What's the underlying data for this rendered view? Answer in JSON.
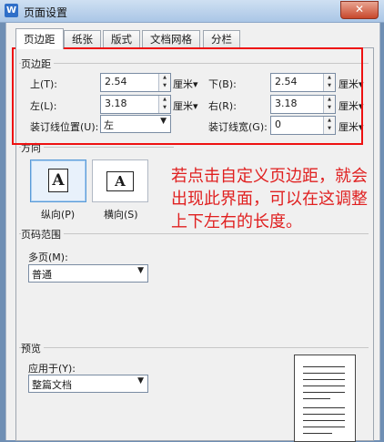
{
  "window": {
    "title": "页面设置",
    "app_icon": "W",
    "close_glyph": "✕"
  },
  "tabs": [
    "页边距",
    "纸张",
    "版式",
    "文档网格",
    "分栏"
  ],
  "margins": {
    "group_label": "页边距",
    "top": {
      "label": "上(T):",
      "value": "2.54",
      "unit": "厘米"
    },
    "bottom": {
      "label": "下(B):",
      "value": "2.54",
      "unit": "厘米"
    },
    "left": {
      "label": "左(L):",
      "value": "3.18",
      "unit": "厘米"
    },
    "right": {
      "label": "右(R):",
      "value": "3.18",
      "unit": "厘米"
    },
    "gutter_position": {
      "label": "装订线位置(U):",
      "value": "左"
    },
    "gutter_width": {
      "label": "装订线宽(G):",
      "value": "0",
      "unit": "厘米"
    }
  },
  "orientation": {
    "group_label": "方向",
    "portrait": {
      "label": "纵向(P)",
      "glyph": "A"
    },
    "landscape": {
      "label": "横向(S)",
      "glyph": "A"
    }
  },
  "page_range": {
    "group_label": "页码范围",
    "multiple_pages_label": "多页(M):",
    "multiple_pages_value": "普通"
  },
  "preview": {
    "group_label": "预览",
    "apply_to_label": "应用于(Y):",
    "apply_to_value": "整篇文档"
  },
  "annotation": {
    "lines": [
      "若点击自定义页边距，就会",
      "出现此界面，可以在这调整",
      "上下左右的长度。"
    ],
    "color": "#e02020"
  }
}
